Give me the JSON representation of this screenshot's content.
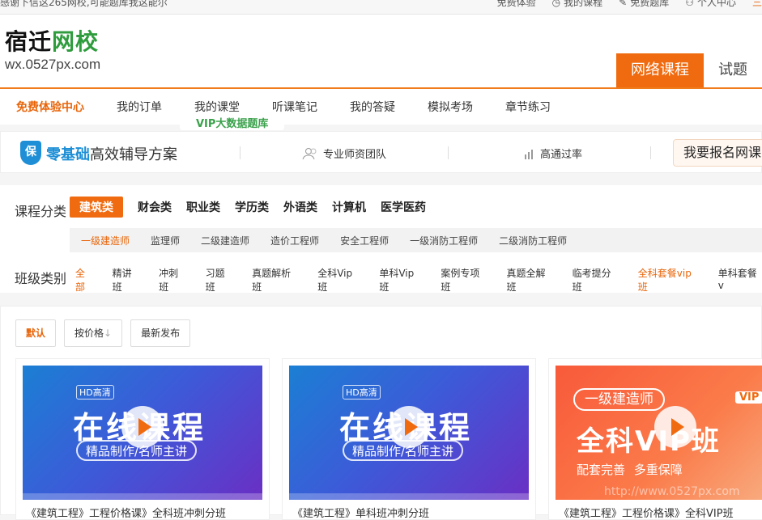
{
  "topbar": {
    "notice": "感谢下信这265网校,可能题库我这能尔",
    "links": [
      "免费体验",
      "我的课程",
      "免费题库",
      "个人中心",
      "三"
    ]
  },
  "header": {
    "brand_part1": "宿迁",
    "brand_part2": "网校",
    "url": "wx.0527px.com",
    "tabs": [
      {
        "label": "网络课程",
        "active": true
      },
      {
        "label": "试题",
        "active": false
      }
    ]
  },
  "subnav": {
    "items": [
      "免费体验中心",
      "我的订单",
      "我的课堂",
      "听课笔记",
      "我的答疑",
      "模拟考场",
      "章节练习",
      "VIP大数据题库"
    ]
  },
  "promo": {
    "shield": "保",
    "slogan_highlight": "零基础",
    "slogan_rest": "高效辅导方案",
    "feature1": "专业师资团队",
    "feature2": "高通过率",
    "signup": "我要报名网课"
  },
  "filter": {
    "category_label": "课程分类",
    "categories": [
      "建筑类",
      "财会类",
      "职业类",
      "学历类",
      "外语类",
      "计算机",
      "医学医药"
    ],
    "subcategories": [
      "一级建造师",
      "监理师",
      "二级建造师",
      "造价工程师",
      "安全工程师",
      "一级消防工程师",
      "二级消防工程师"
    ],
    "class_label": "班级类别",
    "classes": [
      "全部",
      "精讲班",
      "冲刺班",
      "习题班",
      "真题解析班",
      "全科Vip班",
      "单科Vip班",
      "案例专项班",
      "真题全解班",
      "临考提分班",
      "全科套餐vip班",
      "单科套餐v"
    ]
  },
  "sort": {
    "default": "默认",
    "price": "按价格",
    "latest": "最新发布"
  },
  "cards": [
    {
      "badge": "HD高清",
      "title": "在线课程",
      "subtitle": "精品制作/名师主讲",
      "caption": "《建筑工程》工程价格课》全科班冲刺分班"
    },
    {
      "badge": "HD高清",
      "title": "在线课程",
      "subtitle": "精品制作/名师主讲",
      "caption": "《建筑工程》单科班冲刺分班"
    },
    {
      "pill": "一级建造师",
      "title": "全科VIP班",
      "subtitle": "配套完善 多重保障",
      "vip": "VIP",
      "watermark": "http://www.0527px.com",
      "caption": "《建筑工程》工程价格课》全科VIP班"
    }
  ]
}
